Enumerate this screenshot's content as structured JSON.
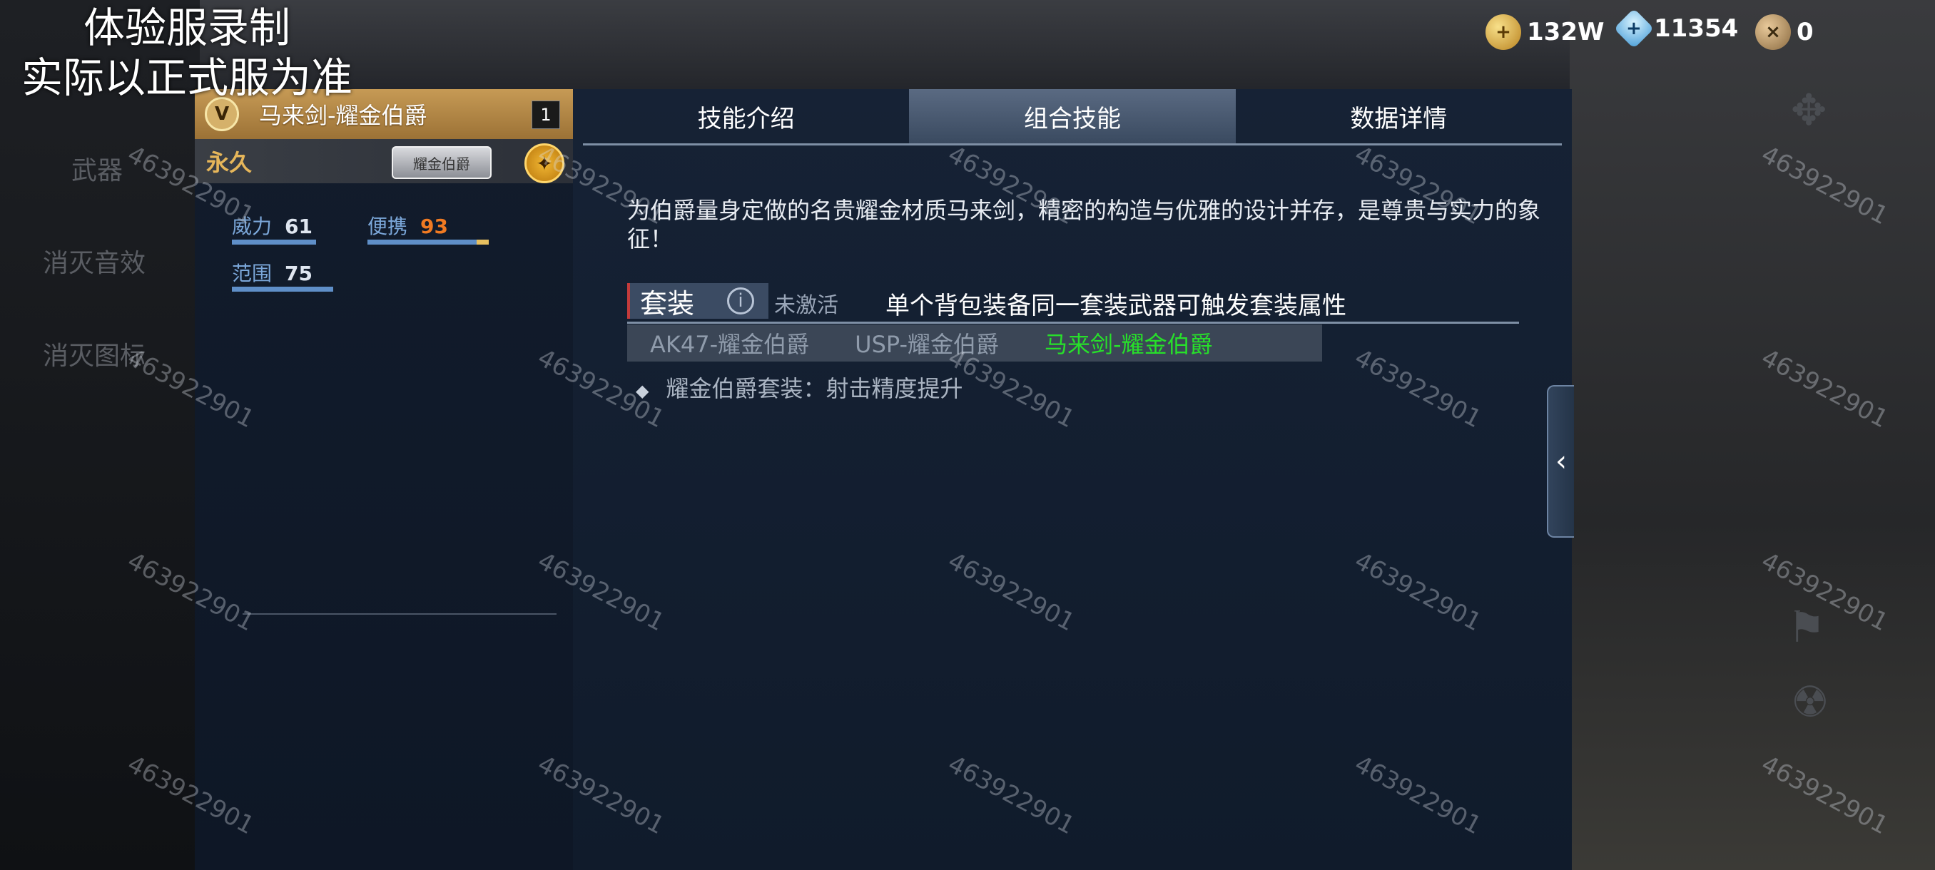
{
  "overlay": {
    "line1": "体验服录制",
    "line2": "实际以正式服为准"
  },
  "bg_menu": [
    "武器",
    "消灭音效",
    "消灭图标"
  ],
  "currency": [
    {
      "icon": "gold-coin-icon",
      "value": "132W"
    },
    {
      "icon": "diamond-icon",
      "value": "11354"
    },
    {
      "icon": "token-icon",
      "value": "0"
    }
  ],
  "weapon": {
    "name": "马来剑-耀金伯爵",
    "count": "1",
    "rank_glyph": "V",
    "duration": "永久",
    "tier": "耀金伯爵",
    "stats": [
      {
        "label": "威力",
        "value": "61",
        "fraction": 0.61
      },
      {
        "label": "便携",
        "value": "93",
        "fraction": 0.93
      },
      {
        "label": "范围",
        "value": "75",
        "fraction": 0.75
      }
    ]
  },
  "tabs": [
    "技能介绍",
    "组合技能",
    "数据详情"
  ],
  "active_tab": 1,
  "description": "为伯爵量身定做的名贵耀金材质马来剑，精密的构造与优雅的设计并存，是尊贵与实力的象征！",
  "set": {
    "title": "套装",
    "info": "i",
    "state": "未激活",
    "rule": "单个背包装备同一套装武器可触发套装属性",
    "items": [
      {
        "name": "AK47-耀金伯爵",
        "equipped": false
      },
      {
        "name": "USP-耀金伯爵",
        "equipped": false
      },
      {
        "name": "马来剑-耀金伯爵",
        "equipped": true
      }
    ],
    "bonus": "耀金伯爵套装：射击精度提升"
  },
  "watermark": "463922901",
  "colors": {
    "gold": "#c69a55",
    "green": "#27e02a",
    "orange": "#f07a22",
    "panel": "#162235"
  }
}
